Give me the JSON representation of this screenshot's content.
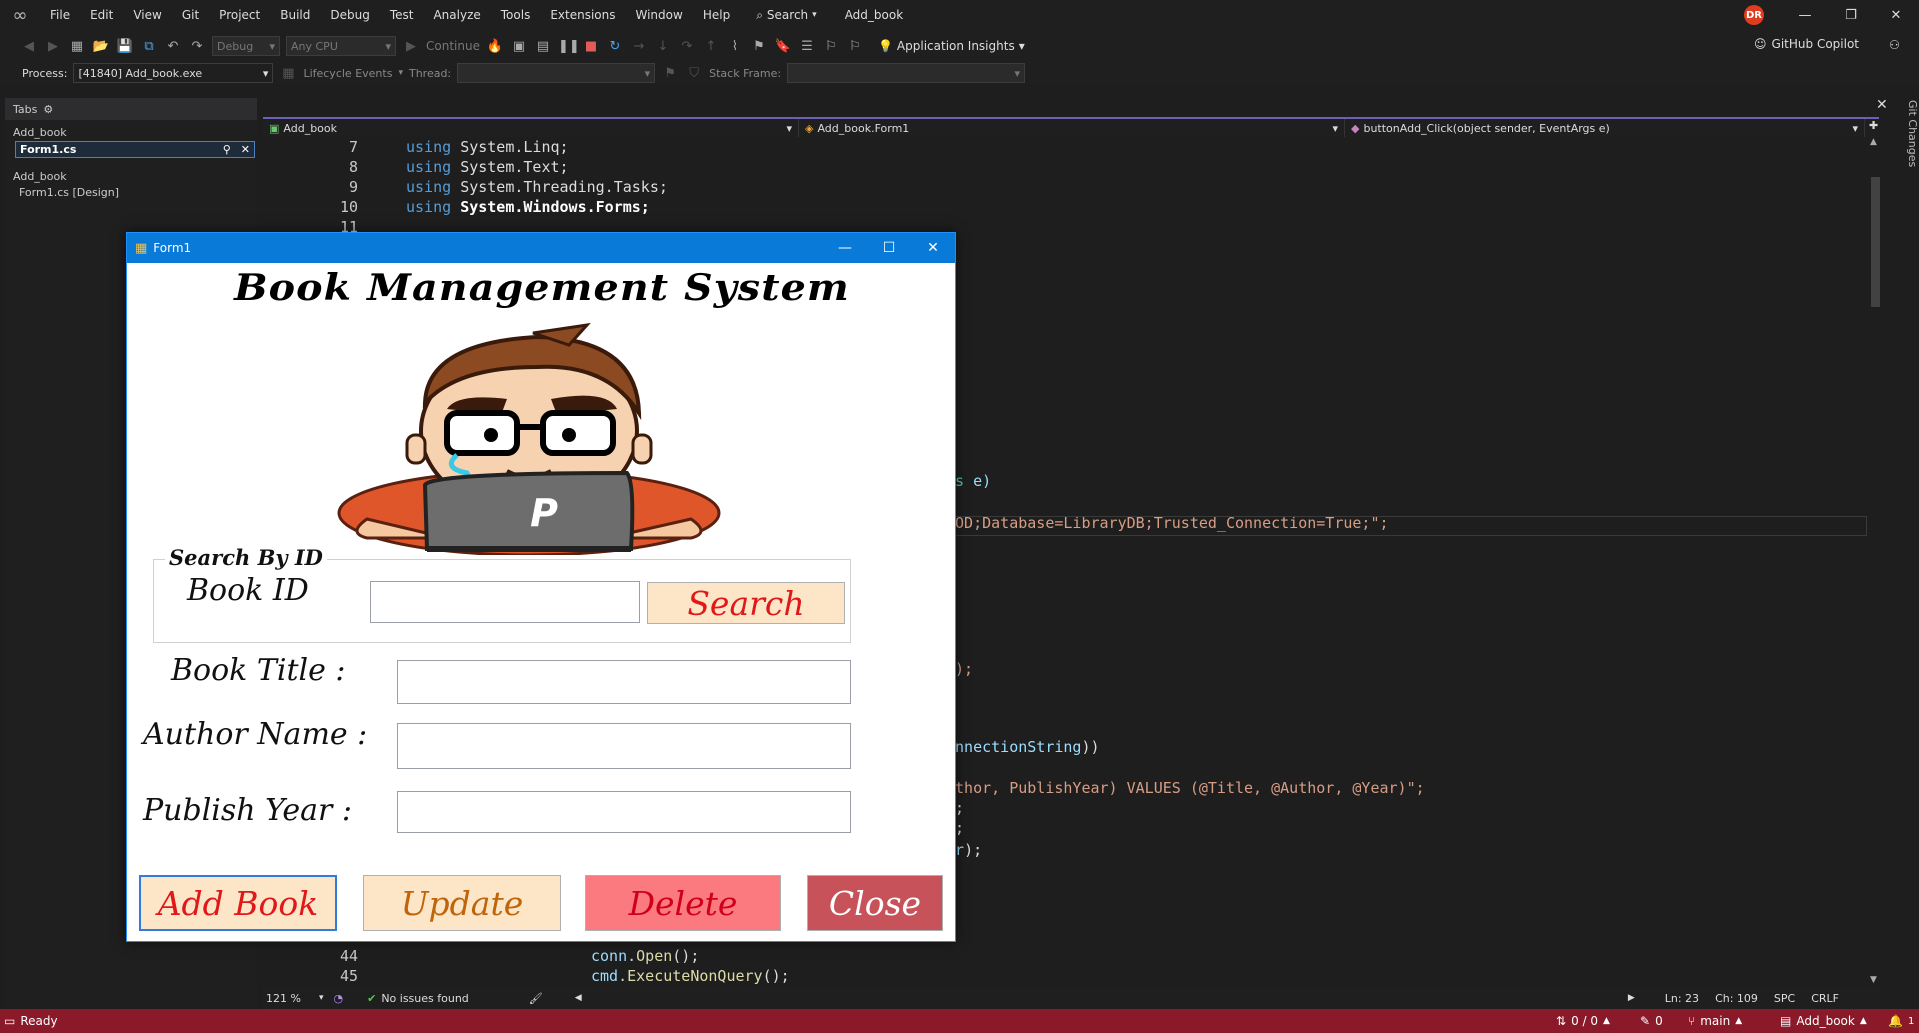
{
  "menu": {
    "items": [
      "File",
      "Edit",
      "View",
      "Git",
      "Project",
      "Build",
      "Debug",
      "Test",
      "Analyze",
      "Tools",
      "Extensions",
      "Window",
      "Help"
    ],
    "search_label": "Search",
    "project_name": "Add_book",
    "avatar_initials": "DR"
  },
  "toolbar": {
    "config": "Debug",
    "platform": "Any CPU",
    "continue_label": "Continue",
    "app_insights": "Application Insights",
    "copilot": "GitHub Copilot"
  },
  "debugbar": {
    "process_label": "Process:",
    "process_value": "[41840] Add_book.exe",
    "lifecycle_label": "Lifecycle Events",
    "thread_label": "Thread:",
    "stack_label": "Stack Frame:"
  },
  "tabs_panel": {
    "header": "Tabs",
    "group1": "Add_book",
    "active_tab": "Form1.cs",
    "group2": "Add_book",
    "item2": "Form1.cs [Design]"
  },
  "navbar": {
    "project": "Add_book",
    "class": "Add_book.Form1",
    "member": "buttonAdd_Click(object sender, EventArgs e)"
  },
  "side_panel": {
    "git_changes": "Git Changes"
  },
  "editor": {
    "lines": [
      {
        "n": "7",
        "kw": "using",
        "ns": "System.Linq;"
      },
      {
        "n": "8",
        "kw": "using",
        "ns": "System.Text;"
      },
      {
        "n": "9",
        "kw": "using",
        "ns": "System.Threading.Tasks;"
      },
      {
        "n": "10",
        "kw": "using",
        "ns": "System.Windows.Forms;"
      },
      {
        "n": "11",
        "kw": "",
        "ns": ""
      }
    ],
    "fragments": {
      "f1a": "gs",
      "f1b": " e)",
      "f2": "MOD;Database=LibraryDB;Trusted_Connection=True;\";",
      "f3": "\");",
      "f4a": "onnectionString",
      "f4b": "))",
      "f5a": "uthor, PublishYear) VALUES (@Title, @Author, @Year)",
      "f5b": "\";",
      "f6": ");",
      "f7": ");",
      "f8a": "or",
      "f8b": ");"
    },
    "bottom_lines": [
      {
        "n": "44",
        "obj": "conn",
        "call": "Open",
        "tail": "();"
      },
      {
        "n": "45",
        "obj": "cmd",
        "call": "ExecuteNonQuery",
        "tail": "();"
      }
    ],
    "zoom": "121 %",
    "issues": "No issues found",
    "ln": "Ln: 23",
    "ch": "Ch: 109",
    "spc": "SPC",
    "crlf": "CRLF"
  },
  "status": {
    "ready": "Ready",
    "sync": "0 / 0",
    "pencil": "0",
    "branch": "main",
    "repo": "Add_book",
    "notif": "1"
  },
  "form": {
    "window_title": "Form1",
    "heading": "Book Management System",
    "avatar_letter": "P",
    "group_label": "Search By ID",
    "book_id_label": "Book ID",
    "search_button": "Search",
    "title_label": "Book Title :",
    "author_label": "Author Name :",
    "year_label": "Publish Year :",
    "add_button": "Add Book",
    "update_button": "Update",
    "delete_button": "Delete",
    "close_button": "Close",
    "colors": {
      "search_bg": "#fde5c8",
      "add_bg": "#fde5c8",
      "update_bg": "#fde5c8",
      "delete_bg": "#fb7a7f",
      "close_bg": "#c8525a"
    }
  }
}
